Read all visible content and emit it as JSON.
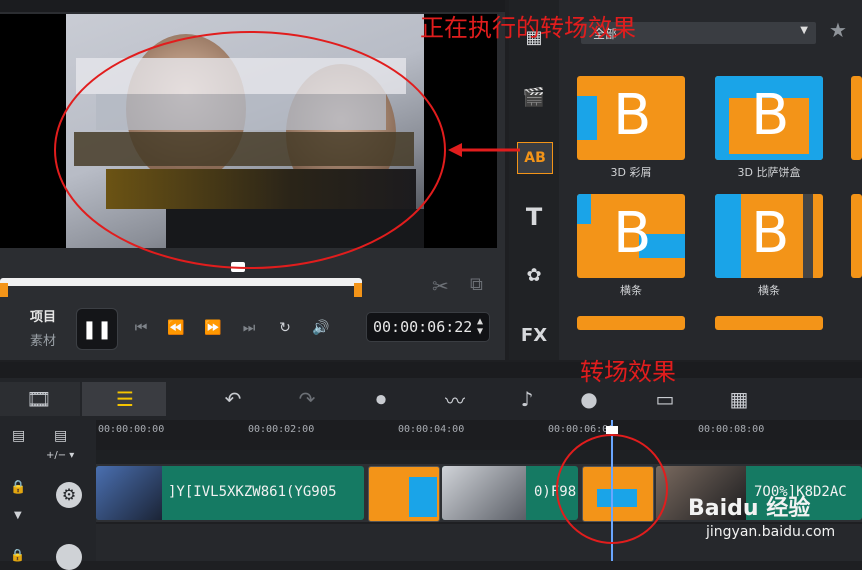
{
  "preview": {
    "project_label": "项目",
    "clip_label": "素材",
    "timecode": "00:00:06:22"
  },
  "library": {
    "dropdown_value": "全部",
    "transitions": [
      {
        "label": "3D 彩屑"
      },
      {
        "label": "3D 比萨饼盒"
      },
      {
        "label": "横条"
      },
      {
        "label": "横条"
      }
    ],
    "side_icons": [
      "media-icon",
      "instant-project-icon",
      "transition-icon",
      "title-icon",
      "graphics-icon",
      "fx-icon"
    ],
    "fx_text": "FX",
    "ab_text": "AB"
  },
  "timeline": {
    "ruler_ticks": [
      "00:00:00:00",
      "00:00:02:00",
      "00:00:04:00",
      "00:00:06:00",
      "00:00:08:00"
    ],
    "clips": [
      {
        "title": "]Y[IVL5XKZW861(YG905"
      },
      {
        "title": "0)F98"
      },
      {
        "title": "7O0%]K8D2AC"
      }
    ]
  },
  "annotations": {
    "top_note": "正在执行的转场效果",
    "mid_note": "转场效果"
  },
  "watermark": {
    "brand": "Baidu 经验",
    "url": "jingyan.baidu.com"
  },
  "colors": {
    "accent_orange": "#f39418",
    "accent_blue": "#1aa4e8",
    "clip_green": "#157a63",
    "annotation_red": "#e11d1d"
  }
}
